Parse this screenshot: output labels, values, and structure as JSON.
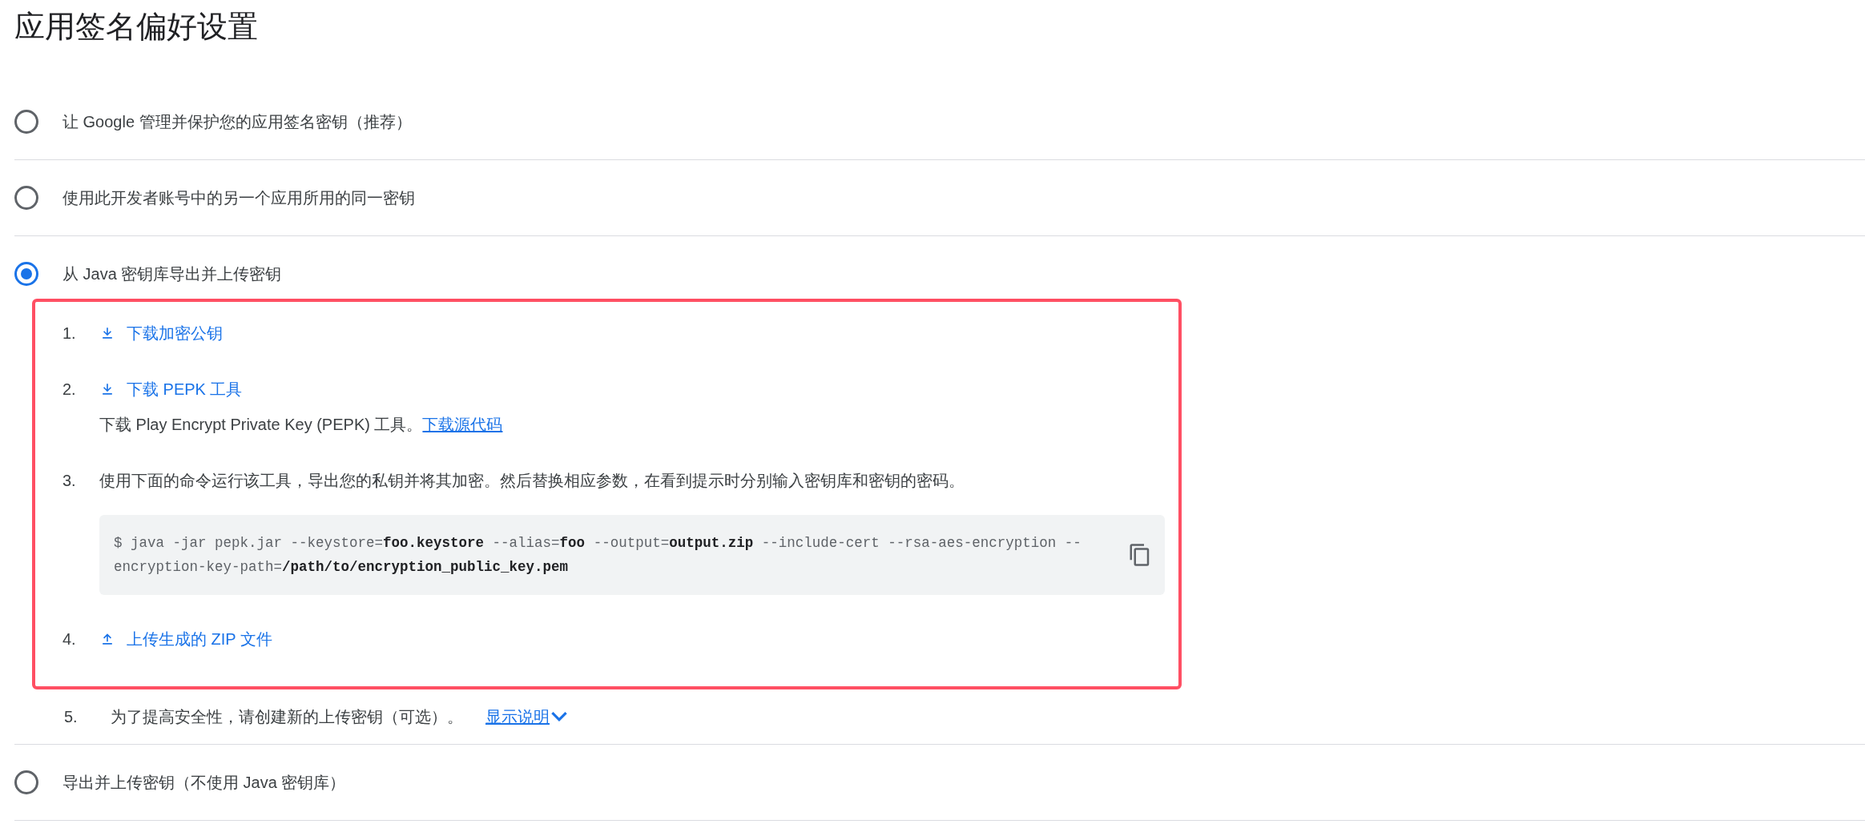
{
  "title": "应用签名偏好设置",
  "options": [
    {
      "label": "让 Google 管理并保护您的应用签名密钥（推荐）",
      "selected": false
    },
    {
      "label": "使用此开发者账号中的另一个应用所用的同一密钥",
      "selected": false
    },
    {
      "label": "从 Java 密钥库导出并上传密钥",
      "selected": true,
      "steps": [
        {
          "number": "1.",
          "kind": "download",
          "link": "下载加密公钥"
        },
        {
          "number": "2.",
          "kind": "download",
          "link": "下载 PEPK 工具",
          "description": "下载 Play Encrypt Private Key (PEPK) 工具。",
          "description_link": "下载源代码"
        },
        {
          "number": "3.",
          "kind": "command",
          "text": "使用下面的命令运行该工具，导出您的私钥并将其加密。然后替换相应参数，在看到提示时分别输入密钥库和密钥的密码。",
          "command": "$ java -jar pepk.jar --keystore=**foo.keystore** --alias=**foo** --output=**output.zip** --include-cert --rsa-aes-encryption --encryption-key-path=**/path/to/encryption_public_key.pem**"
        },
        {
          "number": "4.",
          "kind": "upload",
          "link": "上传生成的 ZIP 文件"
        }
      ],
      "extra_step": {
        "number": "5.",
        "text": "为了提高安全性，请创建新的上传密钥（可选）。",
        "link": "显示说明",
        "expanded": false
      }
    },
    {
      "label": "导出并上传密钥（不使用 Java 密钥库）",
      "selected": false
    }
  ]
}
